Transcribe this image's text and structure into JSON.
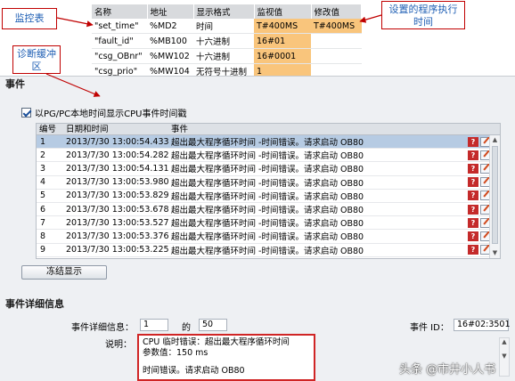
{
  "watch_table": {
    "headers": [
      "名称",
      "地址",
      "显示格式",
      "监视值",
      "修改值"
    ],
    "rows": [
      {
        "name": "\"set_time\"",
        "addr": "%MD2",
        "fmt": "时间",
        "mon": "T#400MS",
        "mod": "T#400MS"
      },
      {
        "name": "\"fault_id\"",
        "addr": "%MB100",
        "fmt": "十六进制",
        "mon": "16#01",
        "mod": ""
      },
      {
        "name": "\"csg_OBnr\"",
        "addr": "%MW102",
        "fmt": "十六进制",
        "mon": "16#0001",
        "mod": ""
      },
      {
        "name": "\"csg_prio\"",
        "addr": "%MW104",
        "fmt": "无符号十进制",
        "mon": "1",
        "mod": ""
      }
    ]
  },
  "callouts": {
    "monitor_table": "监控表",
    "set_program_time": "设置的程序执行时间",
    "diag_buffer": "诊断缓冲区"
  },
  "events": {
    "title": "事件",
    "checkbox_label": "以PG/PC本地时间显示CPU事件时间戳",
    "columns": [
      "编号",
      "日期和时间",
      "事件"
    ],
    "rows": [
      {
        "num": "1",
        "time": "2013/7/30 13:00:54.433",
        "event": "超出最大程序循环时间 -时间错误。请求启动 OB80"
      },
      {
        "num": "2",
        "time": "2013/7/30 13:00:54.282",
        "event": "超出最大程序循环时间 -时间错误。请求启动 OB80"
      },
      {
        "num": "3",
        "time": "2013/7/30 13:00:54.131",
        "event": "超出最大程序循环时间 -时间错误。请求启动 OB80"
      },
      {
        "num": "4",
        "time": "2013/7/30 13:00:53.980",
        "event": "超出最大程序循环时间 -时间错误。请求启动 OB80"
      },
      {
        "num": "5",
        "time": "2013/7/30 13:00:53.829",
        "event": "超出最大程序循环时间 -时间错误。请求启动 OB80"
      },
      {
        "num": "6",
        "time": "2013/7/30 13:00:53.678",
        "event": "超出最大程序循环时间 -时间错误。请求启动 OB80"
      },
      {
        "num": "7",
        "time": "2013/7/30 13:00:53.527",
        "event": "超出最大程序循环时间 -时间错误。请求启动 OB80"
      },
      {
        "num": "8",
        "time": "2013/7/30 13:00:53.376",
        "event": "超出最大程序循环时间 -时间错误。请求启动 OB80"
      },
      {
        "num": "9",
        "time": "2013/7/30 13:00:53.225",
        "event": "超出最大程序循环时间 -时间错误。请求启动 OB80"
      }
    ],
    "freeze_button": "冻结显示"
  },
  "details": {
    "title": "事件详细信息",
    "info_label": "事件详细信息：",
    "info_value": "1",
    "of_label": "的",
    "of_value": "50",
    "event_id_label": "事件 ID：",
    "event_id_value": "16#02:3501",
    "desc_label": "说明：",
    "desc_line1": "CPU 临时错误：超出最大程序循环时间",
    "desc_line2": "参数值：150 ms",
    "desc_line3": "时间错误。请求启动 OB80"
  },
  "watermark": "头条 @市井小人书",
  "colors": {
    "highlight": "#f9c57c",
    "selected_row": "#b6cbe3",
    "callout_border": "#c00000",
    "callout_text": "#1f5fb4"
  }
}
